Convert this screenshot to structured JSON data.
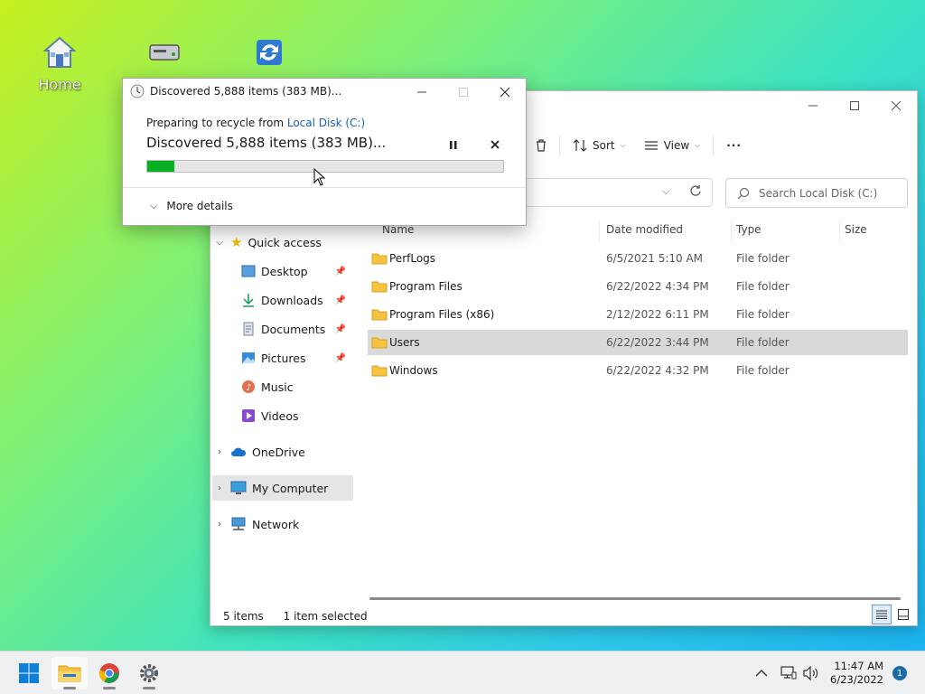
{
  "desktop": {
    "icons": [
      {
        "name": "home-icon",
        "label": "Home"
      },
      {
        "name": "drive-icon",
        "label": ""
      },
      {
        "name": "sync-icon",
        "label": ""
      }
    ]
  },
  "explorer": {
    "toolbar": {
      "sort": "Sort",
      "view": "View",
      "more": "···"
    },
    "search_placeholder": "Search Local Disk (C:)",
    "nav": {
      "quick_access": "Quick access",
      "pinned": [
        "Desktop",
        "Downloads",
        "Documents",
        "Pictures"
      ],
      "unpinned": [
        "Music",
        "Videos"
      ],
      "onedrive": "OneDrive",
      "my_computer": "My Computer",
      "network": "Network"
    },
    "columns": {
      "name": "Name",
      "date": "Date modified",
      "type": "Type",
      "size": "Size"
    },
    "files": [
      {
        "name": "PerfLogs",
        "date": "6/5/2021 5:10 AM",
        "type": "File folder"
      },
      {
        "name": "Program Files",
        "date": "6/22/2022 4:34 PM",
        "type": "File folder"
      },
      {
        "name": "Program Files (x86)",
        "date": "2/12/2022 6:11 PM",
        "type": "File folder"
      },
      {
        "name": "Users",
        "date": "6/22/2022 3:44 PM",
        "type": "File folder",
        "selected": true
      },
      {
        "name": "Windows",
        "date": "6/22/2022 4:32 PM",
        "type": "File folder"
      }
    ],
    "status": {
      "count": "5 items",
      "selected": "1 item selected"
    }
  },
  "dialog": {
    "title": "Discovered 5,888 items (383 MB)...",
    "from_prefix": "Preparing to recycle from",
    "from_link": "Local Disk (C:)",
    "main": "Discovered 5,888 items (383 MB)...",
    "progress": 0.075,
    "more_details": "More details"
  },
  "taskbar": {
    "time": "11:47 AM",
    "date": "6/23/2022",
    "notifications": "1"
  },
  "colors": {
    "progress": "#06b025",
    "link": "#1a5fb4",
    "accent": "#0067c0"
  }
}
